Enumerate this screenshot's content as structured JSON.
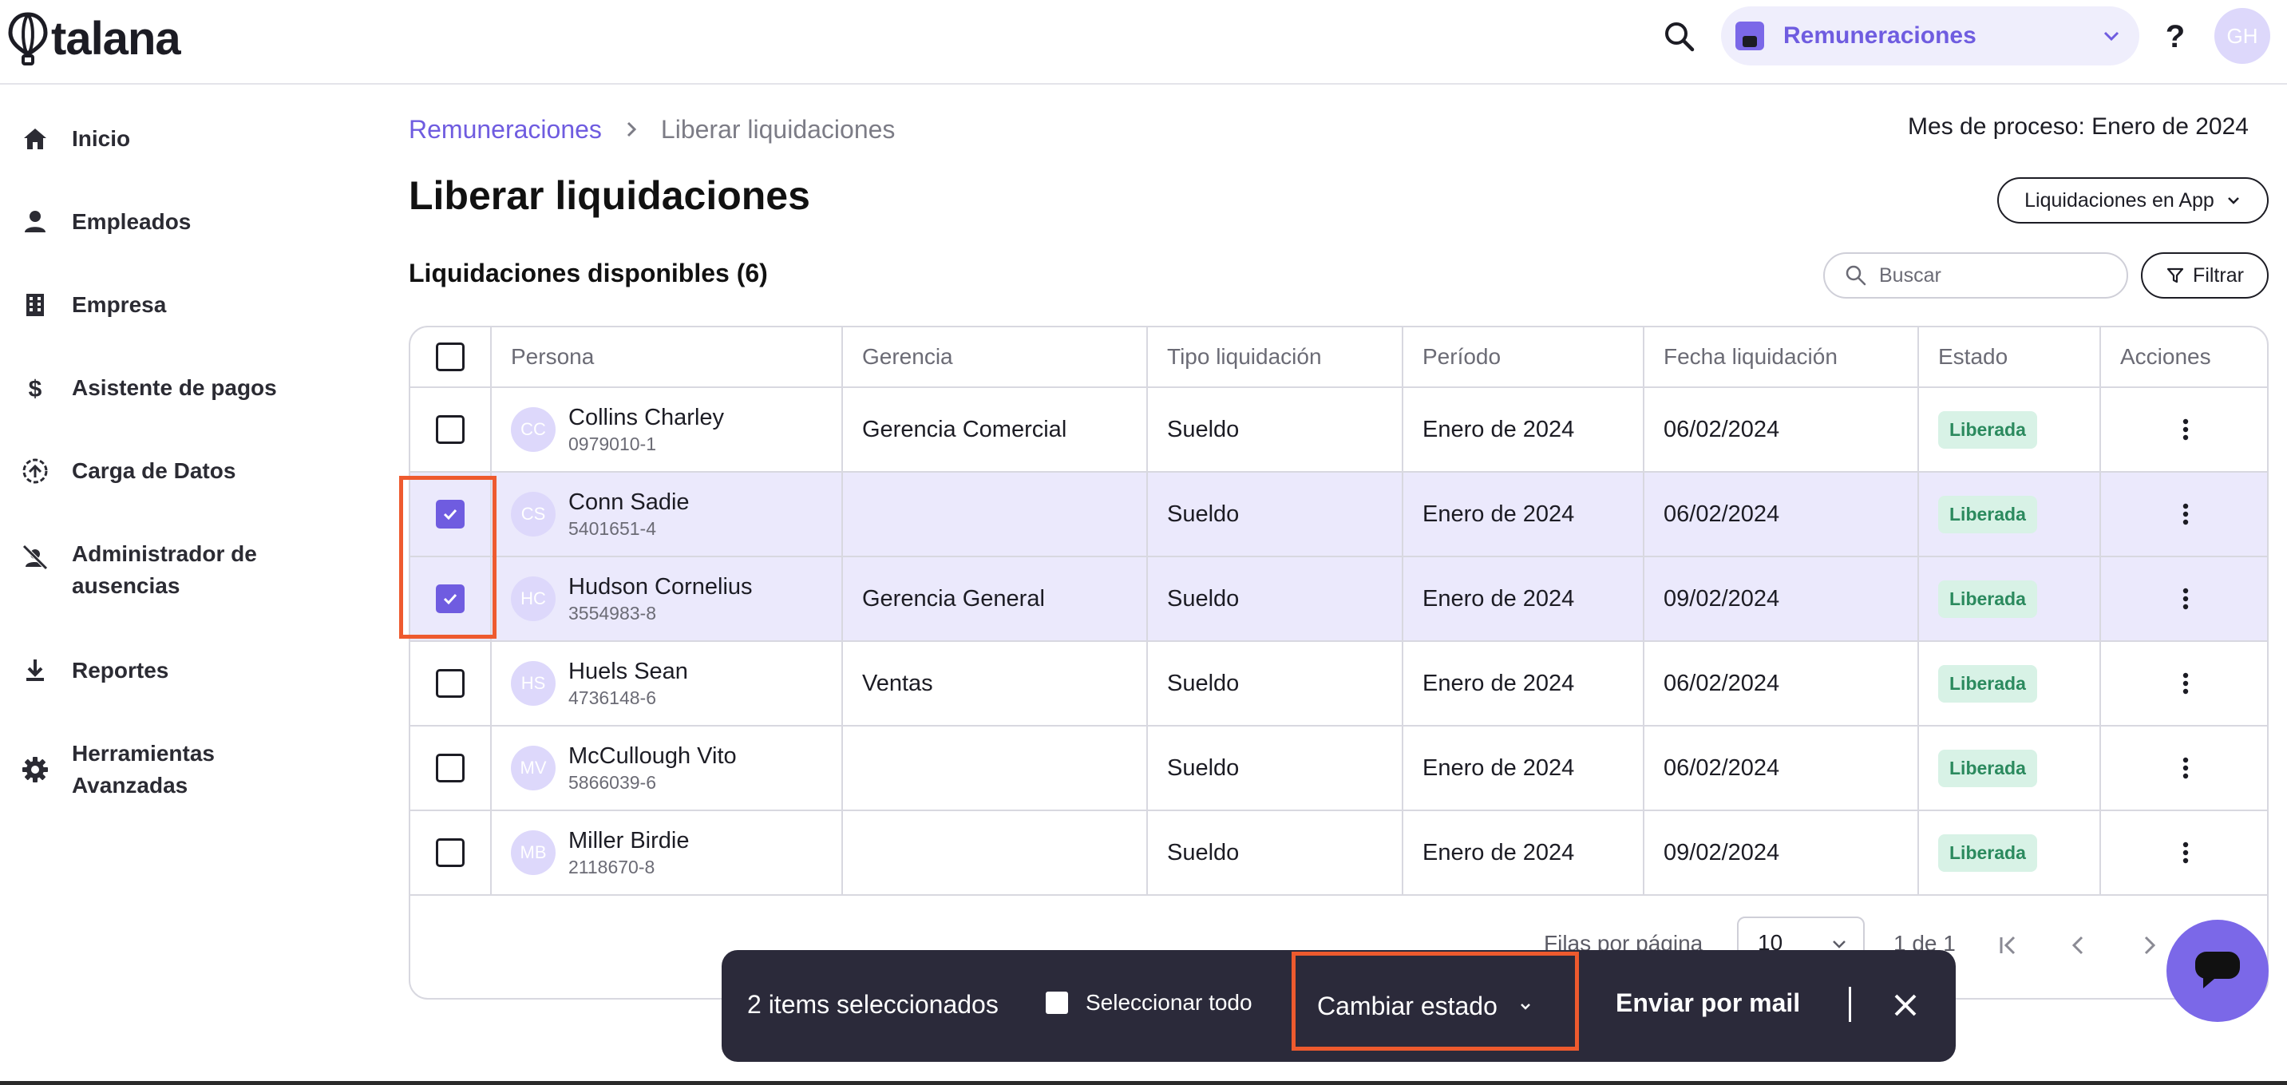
{
  "app": {
    "logo_text": "talana"
  },
  "topbar": {
    "module": "Remuneraciones",
    "help": "?",
    "user_initials": "GH"
  },
  "sidebar": {
    "items": [
      {
        "label": "Inicio",
        "icon": "home-icon"
      },
      {
        "label": "Empleados",
        "icon": "person-icon"
      },
      {
        "label": "Empresa",
        "icon": "building-icon"
      },
      {
        "label": "Asistente de pagos",
        "icon": "dollar-icon"
      },
      {
        "label": "Carga de Datos",
        "icon": "upload-icon"
      },
      {
        "label": "Administrador de ausencias",
        "icon": "person-off-icon"
      },
      {
        "label": "Reportes",
        "icon": "download-icon"
      },
      {
        "label": "Herramientas Avanzadas",
        "icon": "gear-icon"
      }
    ]
  },
  "breadcrumb": {
    "parent": "Remuneraciones",
    "current": "Liberar liquidaciones"
  },
  "process_month": "Mes de proceso: Enero de 2024",
  "page_title": "Liberar liquidaciones",
  "app_button": "Liquidaciones en App",
  "section_title": "Liquidaciones disponibles (6)",
  "search": {
    "placeholder": "Buscar",
    "value": ""
  },
  "filter_label": "Filtrar",
  "table": {
    "columns": [
      "Persona",
      "Gerencia",
      "Tipo liquidación",
      "Período",
      "Fecha liquidación",
      "Estado",
      "Acciones"
    ],
    "rows": [
      {
        "initials": "CC",
        "name": "Collins Charley",
        "id": "0979010-1",
        "gerencia": "Gerencia Comercial",
        "tipo": "Sueldo",
        "periodo": "Enero de 2024",
        "fecha": "06/02/2024",
        "estado": "Liberada",
        "selected": false
      },
      {
        "initials": "CS",
        "name": "Conn Sadie",
        "id": "5401651-4",
        "gerencia": "",
        "tipo": "Sueldo",
        "periodo": "Enero de 2024",
        "fecha": "06/02/2024",
        "estado": "Liberada",
        "selected": true
      },
      {
        "initials": "HC",
        "name": "Hudson Cornelius",
        "id": "3554983-8",
        "gerencia": "Gerencia General",
        "tipo": "Sueldo",
        "periodo": "Enero de 2024",
        "fecha": "09/02/2024",
        "estado": "Liberada",
        "selected": true
      },
      {
        "initials": "HS",
        "name": "Huels Sean",
        "id": "4736148-6",
        "gerencia": "Ventas",
        "tipo": "Sueldo",
        "periodo": "Enero de 2024",
        "fecha": "06/02/2024",
        "estado": "Liberada",
        "selected": false
      },
      {
        "initials": "MV",
        "name": "McCullough Vito",
        "id": "5866039-6",
        "gerencia": "",
        "tipo": "Sueldo",
        "periodo": "Enero de 2024",
        "fecha": "06/02/2024",
        "estado": "Liberada",
        "selected": false
      },
      {
        "initials": "MB",
        "name": "Miller Birdie",
        "id": "2118670-8",
        "gerencia": "",
        "tipo": "Sueldo",
        "periodo": "Enero de 2024",
        "fecha": "09/02/2024",
        "estado": "Liberada",
        "selected": false
      }
    ]
  },
  "pagination": {
    "rows_label": "Filas por página",
    "rows_value": "10",
    "range": "1 de 1"
  },
  "selection_bar": {
    "count": "2 items seleccionados",
    "select_all": "Seleccionar todo",
    "change_state": "Cambiar estado",
    "send_mail": "Enviar por mail"
  },
  "colors": {
    "accent": "#6f5ce0",
    "badge_bg": "#d8f2e6",
    "highlight": "#ee5a2e",
    "bar_bg": "#2b2a3a"
  }
}
